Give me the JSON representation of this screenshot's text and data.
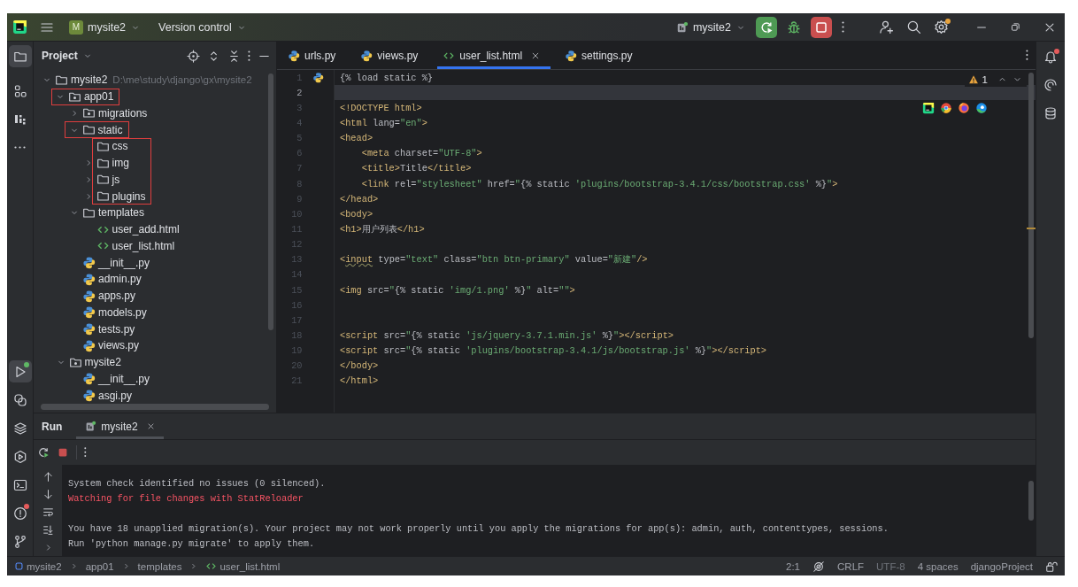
{
  "title_bar": {
    "project_badge": "M",
    "project": "mysite2",
    "vcs": "Version control",
    "run_config": "mysite2",
    "actions": [
      {
        "kind": "add-user",
        "badge": false
      },
      {
        "kind": "search",
        "badge": false
      },
      {
        "kind": "settings",
        "badge": true
      }
    ]
  },
  "left_toolbar": {
    "top": [
      {
        "kind": "folder",
        "selected": true,
        "badge": false
      },
      {
        "kind": "structure",
        "selected": false,
        "badge": false
      },
      {
        "kind": "django",
        "selected": false,
        "badge": false
      },
      {
        "kind": "more",
        "selected": false,
        "badge": false
      }
    ],
    "bottom": [
      {
        "kind": "run",
        "selected": true,
        "badge": true
      },
      {
        "kind": "python",
        "selected": false,
        "badge": false
      },
      {
        "kind": "layers",
        "selected": false,
        "badge": false
      },
      {
        "kind": "services",
        "selected": false,
        "badge": false
      },
      {
        "kind": "terminal",
        "selected": false,
        "badge": false
      },
      {
        "kind": "problems",
        "selected": false,
        "badge": true
      },
      {
        "kind": "git",
        "selected": false,
        "badge": false
      }
    ]
  },
  "right_toolbar": [
    {
      "kind": "bell",
      "badge": true
    },
    {
      "kind": "ai",
      "badge": false
    },
    {
      "kind": "database",
      "badge": false
    }
  ],
  "project_panel": {
    "title": "Project",
    "tree": [
      {
        "name": "mysite2",
        "path": "D:\\me\\study\\django\\gx\\mysite2",
        "kind": "folder",
        "expanded": true,
        "highlighted": false,
        "children": [
          {
            "name": "app01",
            "kind": "package",
            "expanded": true,
            "highlighted": true,
            "children": [
              {
                "name": "migrations",
                "kind": "package",
                "expanded": false,
                "highlighted": false
              },
              {
                "name": "static",
                "kind": "folder",
                "expanded": true,
                "highlighted": true,
                "children_framed": true,
                "children": [
                  {
                    "name": "css",
                    "kind": "folder",
                    "highlighted": false
                  },
                  {
                    "name": "img",
                    "kind": "folder",
                    "expanded": false,
                    "highlighted": false
                  },
                  {
                    "name": "js",
                    "kind": "folder",
                    "expanded": false,
                    "highlighted": false
                  },
                  {
                    "name": "plugins",
                    "kind": "folder",
                    "expanded": false,
                    "highlighted": false
                  }
                ]
              },
              {
                "name": "templates",
                "kind": "folder",
                "expanded": true,
                "highlighted": false,
                "children": [
                  {
                    "name": "user_add.html",
                    "kind": "html",
                    "highlighted": false
                  },
                  {
                    "name": "user_list.html",
                    "kind": "html",
                    "highlighted": false
                  }
                ]
              },
              {
                "name": "__init__.py",
                "kind": "python",
                "highlighted": false
              },
              {
                "name": "admin.py",
                "kind": "python",
                "highlighted": false
              },
              {
                "name": "apps.py",
                "kind": "python",
                "highlighted": false
              },
              {
                "name": "models.py",
                "kind": "python",
                "highlighted": false
              },
              {
                "name": "tests.py",
                "kind": "python",
                "highlighted": false
              },
              {
                "name": "views.py",
                "kind": "python",
                "highlighted": false
              }
            ]
          },
          {
            "name": "mysite2",
            "kind": "package",
            "expanded": true,
            "highlighted": false,
            "children": [
              {
                "name": "__init__.py",
                "kind": "python",
                "highlighted": false
              },
              {
                "name": "asgi.py",
                "kind": "python",
                "highlighted": false
              }
            ]
          }
        ]
      }
    ]
  },
  "editor": {
    "tabs": [
      {
        "kind": "python",
        "label": "urls.py",
        "selected": false
      },
      {
        "kind": "python",
        "label": "views.py",
        "selected": false
      },
      {
        "kind": "html",
        "label": "user_list.html",
        "selected": true
      },
      {
        "kind": "python",
        "label": "settings.py",
        "selected": false
      }
    ],
    "warnings": "1",
    "lines": [
      {
        "number": "1",
        "current": false,
        "tokens": [
          {
            "kind": "plain",
            "text": "{% load static %}"
          }
        ]
      },
      {
        "number": "2",
        "current": true
      },
      {
        "number": "3",
        "current": false,
        "tokens": [
          {
            "kind": "tag",
            "text": "<!DOCTYPE html>"
          }
        ]
      },
      {
        "number": "4",
        "current": false,
        "tokens": [
          {
            "kind": "tag",
            "text": "<html"
          },
          {
            "kind": "attr",
            "text": " lang="
          },
          {
            "kind": "str",
            "text": "\"en\""
          },
          {
            "kind": "tag",
            "text": ">"
          }
        ]
      },
      {
        "number": "5",
        "current": false,
        "tokens": [
          {
            "kind": "tag",
            "text": "<head>"
          }
        ]
      },
      {
        "number": "6",
        "current": false,
        "tokens": [
          {
            "kind": "tag",
            "text": "    <meta"
          },
          {
            "kind": "attr",
            "text": " charset="
          },
          {
            "kind": "str",
            "text": "\"UTF-8\""
          },
          {
            "kind": "tag",
            "text": ">"
          }
        ]
      },
      {
        "number": "7",
        "current": false,
        "tokens": [
          {
            "kind": "tag",
            "text": "    <title>"
          },
          {
            "kind": "plain",
            "text": "Title"
          },
          {
            "kind": "tag",
            "text": "</title>"
          }
        ]
      },
      {
        "number": "8",
        "current": false,
        "tokens": [
          {
            "kind": "tag",
            "text": "    <link"
          },
          {
            "kind": "attr",
            "text": " rel="
          },
          {
            "kind": "str",
            "text": "\"stylesheet\""
          },
          {
            "kind": "attr",
            "text": " href="
          },
          {
            "kind": "str",
            "text": "\""
          },
          {
            "kind": "plain",
            "text": "{% static "
          },
          {
            "kind": "str",
            "text": "'plugins/bootstrap-3.4.1/css/bootstrap.css'"
          },
          {
            "kind": "plain",
            "text": " %}"
          },
          {
            "kind": "str",
            "text": "\""
          },
          {
            "kind": "tag",
            "text": ">"
          }
        ]
      },
      {
        "number": "9",
        "current": false,
        "tokens": [
          {
            "kind": "tag",
            "text": "</head>"
          }
        ]
      },
      {
        "number": "10",
        "current": false,
        "tokens": [
          {
            "kind": "tag",
            "text": "<body>"
          }
        ]
      },
      {
        "number": "11",
        "current": false,
        "tokens": [
          {
            "kind": "tag",
            "text": "<h1>"
          },
          {
            "kind": "plain",
            "text": "用户列表"
          },
          {
            "kind": "tag",
            "text": "</h1>"
          }
        ]
      },
      {
        "number": "12",
        "current": false
      },
      {
        "number": "13",
        "current": false,
        "tokens": [
          {
            "kind": "tag",
            "text": "<"
          },
          {
            "kind": "warn",
            "text": "input"
          },
          {
            "kind": "attr",
            "text": " type="
          },
          {
            "kind": "str",
            "text": "\"text\""
          },
          {
            "kind": "attr",
            "text": " class="
          },
          {
            "kind": "str",
            "text": "\"btn btn-primary\""
          },
          {
            "kind": "attr",
            "text": " value="
          },
          {
            "kind": "str",
            "text": "\"新建\""
          },
          {
            "kind": "tag",
            "text": "/>"
          }
        ]
      },
      {
        "number": "14",
        "current": false
      },
      {
        "number": "15",
        "current": false,
        "tokens": [
          {
            "kind": "tag",
            "text": "<img"
          },
          {
            "kind": "attr",
            "text": " src="
          },
          {
            "kind": "str",
            "text": "\""
          },
          {
            "kind": "plain",
            "text": "{% static "
          },
          {
            "kind": "str",
            "text": "'img/1.png'"
          },
          {
            "kind": "plain",
            "text": " %}"
          },
          {
            "kind": "str",
            "text": "\""
          },
          {
            "kind": "attr",
            "text": " alt="
          },
          {
            "kind": "str",
            "text": "\"\""
          },
          {
            "kind": "tag",
            "text": ">"
          }
        ]
      },
      {
        "number": "16",
        "current": false
      },
      {
        "number": "17",
        "current": false
      },
      {
        "number": "18",
        "current": false,
        "tokens": [
          {
            "kind": "tag",
            "text": "<script"
          },
          {
            "kind": "attr",
            "text": " src="
          },
          {
            "kind": "str",
            "text": "\""
          },
          {
            "kind": "plain",
            "text": "{% static "
          },
          {
            "kind": "str",
            "text": "'js/jquery-3.7.1.min.js'"
          },
          {
            "kind": "plain",
            "text": " %}"
          },
          {
            "kind": "str",
            "text": "\""
          },
          {
            "kind": "tag",
            "text": "></script>"
          }
        ]
      },
      {
        "number": "19",
        "current": false,
        "tokens": [
          {
            "kind": "tag",
            "text": "<script"
          },
          {
            "kind": "attr",
            "text": " src="
          },
          {
            "kind": "str",
            "text": "\""
          },
          {
            "kind": "plain",
            "text": "{% static "
          },
          {
            "kind": "str",
            "text": "'plugins/bootstrap-3.4.1/js/bootstrap.js'"
          },
          {
            "kind": "plain",
            "text": " %}"
          },
          {
            "kind": "str",
            "text": "\""
          },
          {
            "kind": "tag",
            "text": "></script>"
          }
        ]
      },
      {
        "number": "20",
        "current": false,
        "tokens": [
          {
            "kind": "tag",
            "text": "</body>"
          }
        ]
      },
      {
        "number": "21",
        "current": false,
        "tokens": [
          {
            "kind": "tag",
            "text": "</html>"
          }
        ]
      }
    ]
  },
  "run_panel": {
    "title": "Run",
    "tabs": [
      {
        "label": "mysite2",
        "selected": true
      }
    ],
    "console": [
      {
        "kind": "normal",
        "text": "System check identified no issues (0 silenced)."
      },
      {
        "kind": "error",
        "text": "Watching for file changes with StatReloader"
      },
      {
        "kind": "blank"
      },
      {
        "kind": "normal",
        "text": "You have 18 unapplied migration(s). Your project may not work properly until you apply the migrations for app(s): admin, auth, contenttypes, sessions."
      },
      {
        "kind": "normal",
        "text": "Run 'python manage.py migrate' to apply them."
      }
    ]
  },
  "status_bar": {
    "breadcrumb": [
      {
        "kind": "module",
        "text": "mysite2"
      },
      {
        "kind": "folder",
        "text": "app01"
      },
      {
        "kind": "folder",
        "text": "templates"
      },
      {
        "kind": "html",
        "text": "user_list.html"
      }
    ],
    "items": [
      {
        "kind": "text",
        "text": "2:1"
      },
      {
        "kind": "crossed"
      },
      {
        "kind": "text",
        "text": "CRLF"
      },
      {
        "kind": "muted",
        "text": "UTF-8"
      },
      {
        "kind": "text",
        "text": "4 spaces"
      },
      {
        "kind": "text",
        "text": "djangoProject"
      },
      {
        "kind": "lock"
      }
    ]
  }
}
